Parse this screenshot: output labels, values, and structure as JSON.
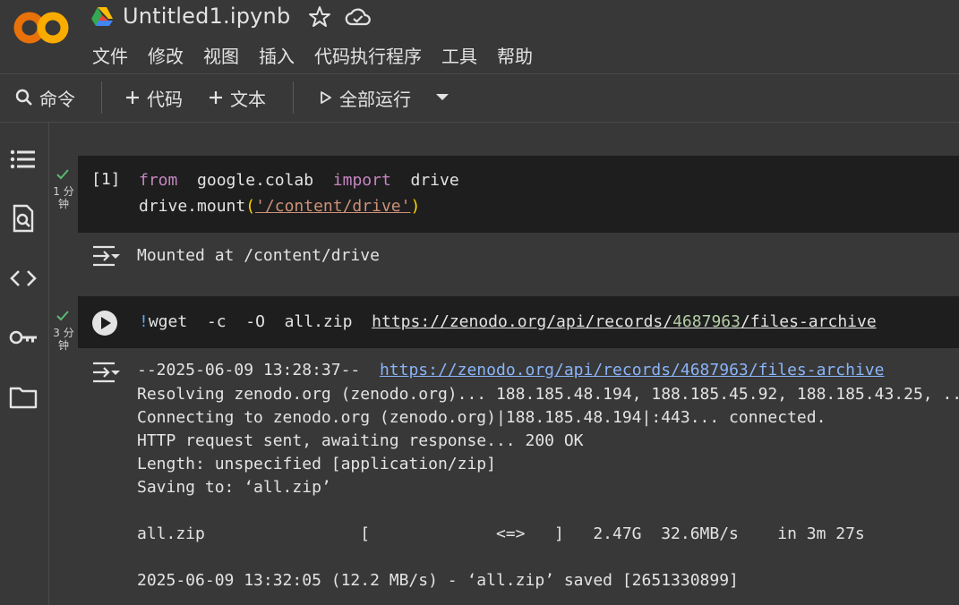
{
  "app": {
    "logo_text": "CO",
    "title": "Untitled1.ipynb",
    "menu": [
      "文件",
      "修改",
      "视图",
      "插入",
      "代码执行程序",
      "工具",
      "帮助"
    ]
  },
  "toolbar": {
    "command_label": "命令",
    "add_code_label": "代码",
    "add_text_label": "文本",
    "run_all_label": "全部运行"
  },
  "rail_icons": [
    "toc-icon",
    "find-icon",
    "code-snippets-icon",
    "secrets-key-icon",
    "files-folder-icon"
  ],
  "cells": [
    {
      "exec_count": "[1]",
      "duration_line1": "1 分",
      "duration_line2": "钟",
      "code": {
        "line1": {
          "kw1": "from",
          "mod": "google.colab",
          "kw2": "import",
          "name": "drive"
        },
        "line2": {
          "prefix": "drive.mount",
          "open": "(",
          "str": "'/content/drive'",
          "close": ")"
        }
      },
      "output": [
        "Mounted at /content/drive"
      ]
    },
    {
      "duration_line1": "3 分",
      "duration_line2": "钟",
      "code": {
        "bang": "!",
        "cmd": "wget",
        "args": "-c  -O  all.zip",
        "url_start": "https://zenodo.org/api/records/",
        "url_num": "4687963",
        "url_end": "/files-archive"
      },
      "output": {
        "l1_prefix": "--2025-06-09 13:28:37--",
        "l1_link": "https://zenodo.org/api/records/4687963/files-archive",
        "l2": "Resolving zenodo.org (zenodo.org)... 188.185.48.194, 188.185.45.92, 188.185.43.25, ...",
        "l3": "Connecting to zenodo.org (zenodo.org)|188.185.48.194|:443... connected.",
        "l4": "HTTP request sent, awaiting response... 200 OK",
        "l5": "Length: unspecified [application/zip]",
        "l6": "Saving to: ‘all.zip’",
        "l7": "all.zip                [             <=>   ]   2.47G  32.6MB/s    in 3m 27s",
        "l8": "2025-06-09 13:32:05 (12.2 MB/s) - ‘all.zip’ saved [2651330899]"
      }
    }
  ],
  "colors": {
    "background": "#383838",
    "cell": "#1e1e1e",
    "keyword": "#c586c0",
    "string": "#ce9178",
    "link": "#8ab4f8",
    "check": "#5bb974",
    "logo": "#f9ab00"
  }
}
